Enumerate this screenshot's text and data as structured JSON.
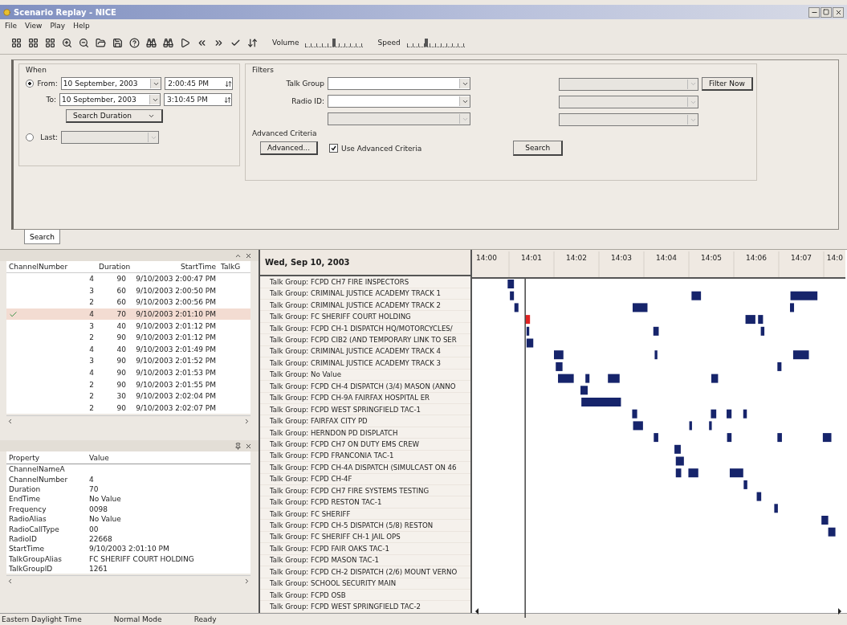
{
  "window": {
    "title": "Scenario Replay - NICE"
  },
  "menu": [
    "File",
    "View",
    "Play",
    "Help"
  ],
  "toolbar": {
    "volume": {
      "label": "Volume",
      "level": 0.5
    },
    "speed": {
      "label": "Speed",
      "level": 0.33
    }
  },
  "when": {
    "title": "When",
    "from": {
      "label": "From:",
      "selected": true,
      "date": "10 September, 2003",
      "time": "2:00:45 PM"
    },
    "to": {
      "label": "To:",
      "date": "10 September, 2003",
      "time": "3:10:45 PM"
    },
    "duration_button": "Search Duration",
    "last": {
      "label": "Last:",
      "selected": false,
      "disabled": true
    }
  },
  "filters": {
    "title": "Filters",
    "talk_group": {
      "label": "Talk Group",
      "disabled": false
    },
    "radio_id": {
      "label": "Radio ID:",
      "disabled": false
    },
    "extra_field": {
      "disabled": true
    },
    "side_fields": [
      {
        "disabled": true
      },
      {
        "disabled": true
      },
      {
        "disabled": true
      }
    ],
    "filter_now": "Filter Now"
  },
  "advanced": {
    "title": "Advanced Criteria",
    "button": "Advanced...",
    "use": {
      "label": "Use Advanced Criteria",
      "checked": true
    }
  },
  "search_button": "Search",
  "tabs": [
    {
      "label": "Search",
      "selected": true
    }
  ],
  "calls_table": {
    "columns": [
      "ChannelNumber",
      "Duration",
      "StartTime",
      "TalkG"
    ],
    "rows": [
      {
        "channel": "4",
        "duration": "90",
        "start": "9/10/2003 2:00:47 PM",
        "selected": false
      },
      {
        "channel": "3",
        "duration": "60",
        "start": "9/10/2003 2:00:50 PM",
        "selected": false
      },
      {
        "channel": "2",
        "duration": "60",
        "start": "9/10/2003 2:00:56 PM",
        "selected": false
      },
      {
        "channel": "4",
        "duration": "70",
        "start": "9/10/2003 2:01:10 PM",
        "selected": true
      },
      {
        "channel": "3",
        "duration": "40",
        "start": "9/10/2003 2:01:12 PM",
        "selected": false
      },
      {
        "channel": "2",
        "duration": "90",
        "start": "9/10/2003 2:01:12 PM",
        "selected": false
      },
      {
        "channel": "4",
        "duration": "40",
        "start": "9/10/2003 2:01:49 PM",
        "selected": false
      },
      {
        "channel": "3",
        "duration": "90",
        "start": "9/10/2003 2:01:52 PM",
        "selected": false
      },
      {
        "channel": "4",
        "duration": "90",
        "start": "9/10/2003 2:01:53 PM",
        "selected": false
      },
      {
        "channel": "2",
        "duration": "90",
        "start": "9/10/2003 2:01:55 PM",
        "selected": false
      },
      {
        "channel": "2",
        "duration": "30",
        "start": "9/10/2003 2:02:04 PM",
        "selected": false
      },
      {
        "channel": "2",
        "duration": "90",
        "start": "9/10/2003 2:02:07 PM",
        "selected": false
      }
    ]
  },
  "properties": {
    "columns": [
      "Property",
      "Value"
    ],
    "rows": [
      {
        "name": "ChannelNameA"
      },
      {
        "name": "ChannelNumber",
        "value": "4"
      },
      {
        "name": "Duration",
        "value": "70"
      },
      {
        "name": "EndTime",
        "value": "No Value"
      },
      {
        "name": "Frequency",
        "value": "0098"
      },
      {
        "name": "RadioAlias",
        "value": "No Value"
      },
      {
        "name": "RadioCallType",
        "value": "00"
      },
      {
        "name": "RadioID",
        "value": "22668"
      },
      {
        "name": "StartTime",
        "value": "9/10/2003 2:01:10 PM"
      },
      {
        "name": "TalkGroupAlias",
        "value": "FC SHERIFF COURT HOLDING"
      },
      {
        "name": "TalkGroupID",
        "value": "1261"
      }
    ]
  },
  "timeline": {
    "date": "Wed, Sep 10, 2003",
    "rows": [
      "Talk Group: FCPD CH7 FIRE INSPECTORS",
      "Talk Group: CRIMINAL JUSTICE ACADEMY TRACK 1",
      "Talk Group: CRIMINAL JUSTICE ACADEMY TRACK 2",
      "Talk Group: FC SHERIFF COURT HOLDING",
      "Talk Group: FCPD CH-1 DISPATCH HQ/MOTORCYCLES/",
      "Talk Group: FCPD CIB2 (AND TEMPORARY LINK TO SER",
      "Talk Group: CRIMINAL JUSTICE ACADEMY TRACK 4",
      "Talk Group: CRIMINAL JUSTICE ACADEMY TRACK 3",
      "Talk Group: No Value",
      "Talk Group: FCPD CH-4 DISPATCH (3/4) MASON (ANNO",
      "Talk Group: FCPD CH-9A FAIRFAX HOSPITAL ER",
      "Talk Group: FCPD WEST SPRINGFIELD TAC-1",
      "Talk Group: FAIRFAX CITY PD",
      "Talk Group: HERNDON PD DISPLATCH",
      "Talk Group: FCPD CH7 ON DUTY EMS CREW",
      "Talk Group: FCPD FRANCONIA TAC-1",
      "Talk Group: FCPD CH-4A DISPATCH (SIMULCAST ON 46",
      "Talk Group: FCPD CH-4F",
      "Talk Group: FCPD CH7 FIRE SYSTEMS TESTING",
      "Talk Group: FCPD RESTON TAC-1",
      "Talk Group: FC SHERIFF",
      "Talk Group: FCPD CH-5 DISPATCH (5/8) RESTON",
      "Talk Group: FC SHERIFF CH-1 JAIL OPS",
      "Talk Group: FCPD FAIR OAKS TAC-1",
      "Talk Group: FCPD MASON TAC-1",
      "Talk Group: FCPD CH-2 DISPATCH (2/6) MOUNT VERNO",
      "Talk Group: SCHOOL SECURITY MAIN",
      "Talk Group: FCPD OSB",
      "Talk Group: FCPD WEST SPRINGFIELD TAC-2"
    ],
    "time_labels": [
      "14:00",
      "14:01",
      "14:02",
      "14:03",
      "14:04",
      "14:05",
      "14:06",
      "14:07",
      "14:0"
    ]
  },
  "status_bar": [
    "Eastern Daylight Time",
    "Normal Mode",
    "Ready"
  ]
}
